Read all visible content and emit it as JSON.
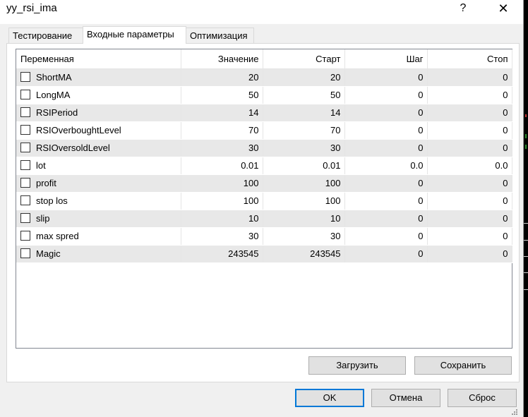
{
  "window": {
    "title": "yy_rsi_ima",
    "help_glyph": "?",
    "close_glyph": "✕"
  },
  "tabs": [
    {
      "label": "Тестирование",
      "active": false
    },
    {
      "label": "Входные параметры",
      "active": true
    },
    {
      "label": "Оптимизация",
      "active": false
    }
  ],
  "grid": {
    "columns": [
      "Переменная",
      "Значение",
      "Старт",
      "Шаг",
      "Стоп"
    ],
    "rows": [
      {
        "name": "ShortMA",
        "value": "20",
        "start": "20",
        "step": "0",
        "stop": "0",
        "checked": false
      },
      {
        "name": "LongMA",
        "value": "50",
        "start": "50",
        "step": "0",
        "stop": "0",
        "checked": false
      },
      {
        "name": "RSIPeriod",
        "value": "14",
        "start": "14",
        "step": "0",
        "stop": "0",
        "checked": false
      },
      {
        "name": "RSIOverboughtLevel",
        "value": "70",
        "start": "70",
        "step": "0",
        "stop": "0",
        "checked": false
      },
      {
        "name": "RSIOversoldLevel",
        "value": "30",
        "start": "30",
        "step": "0",
        "stop": "0",
        "checked": false
      },
      {
        "name": "lot",
        "value": "0.01",
        "start": "0.01",
        "step": "0.0",
        "stop": "0.0",
        "checked": false
      },
      {
        "name": "profit",
        "value": "100",
        "start": "100",
        "step": "0",
        "stop": "0",
        "checked": false
      },
      {
        "name": "stop los",
        "value": "100",
        "start": "100",
        "step": "0",
        "stop": "0",
        "checked": false
      },
      {
        "name": "slip",
        "value": "10",
        "start": "10",
        "step": "0",
        "stop": "0",
        "checked": false
      },
      {
        "name": "max spred",
        "value": "30",
        "start": "30",
        "step": "0",
        "stop": "0",
        "checked": false
      },
      {
        "name": "Magic",
        "value": "243545",
        "start": "243545",
        "step": "0",
        "stop": "0",
        "checked": false
      }
    ]
  },
  "buttons": {
    "load": "Загрузить",
    "save": "Сохранить",
    "ok": "OK",
    "cancel": "Отмена",
    "reset": "Сброс"
  },
  "colors": {
    "accent": "#0078d7",
    "alt_row": "#e8e8e8"
  }
}
